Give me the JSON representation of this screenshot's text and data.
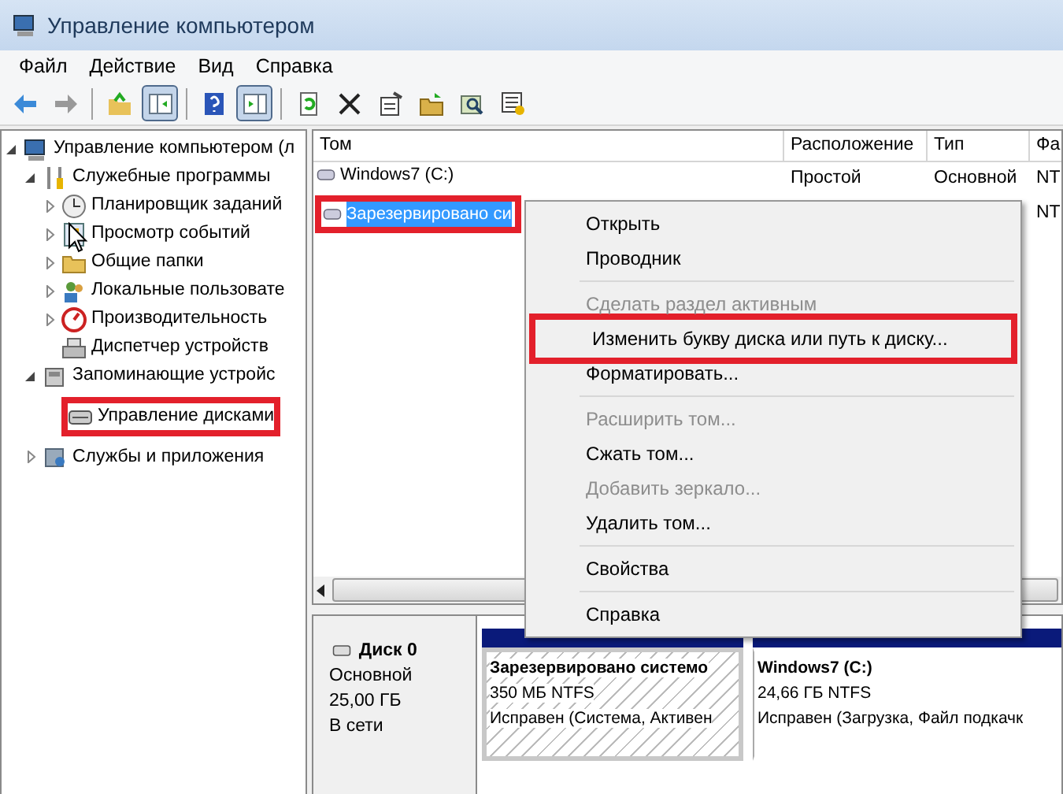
{
  "window": {
    "title": "Управление компьютером"
  },
  "menu_bar": [
    "Файл",
    "Действие",
    "Вид",
    "Справка"
  ],
  "toolbar": [
    {
      "kind": "back",
      "pressed": false
    },
    {
      "kind": "forward",
      "pressed": false
    },
    {
      "kind": "separator"
    },
    {
      "kind": "folder-up",
      "pressed": false
    },
    {
      "kind": "tree-pane",
      "pressed": true
    },
    {
      "kind": "separator"
    },
    {
      "kind": "help",
      "pressed": false
    },
    {
      "kind": "action-pane",
      "pressed": true
    },
    {
      "kind": "separator"
    },
    {
      "kind": "refresh",
      "pressed": false
    },
    {
      "kind": "delete",
      "pressed": false
    },
    {
      "kind": "properties",
      "pressed": false
    },
    {
      "kind": "open",
      "pressed": false
    },
    {
      "kind": "find",
      "pressed": false
    },
    {
      "kind": "export",
      "pressed": false
    }
  ],
  "tree": [
    {
      "label": "Управление компьютером (л",
      "expanded": true,
      "children": [
        {
          "label": "Служебные программы",
          "expanded": true,
          "children": [
            {
              "label": "Планировщик заданий",
              "expanded": false
            },
            {
              "label": "Просмотр событий",
              "expanded": false
            },
            {
              "label": "Общие папки",
              "expanded": false
            },
            {
              "label": "Локальные пользовате",
              "expanded": false
            },
            {
              "label": "Производительность",
              "expanded": false
            },
            {
              "label": "Диспетчер устройств"
            }
          ]
        },
        {
          "label": "Запоминающие устройс",
          "expanded": true,
          "children": [
            {
              "label": "Управление дисками",
              "highlighted": true
            }
          ]
        },
        {
          "label": "Службы и приложения",
          "expanded": false
        }
      ]
    }
  ],
  "volumes": {
    "columns": [
      "Том",
      "Расположение",
      "Тип",
      "Фа"
    ],
    "rows": [
      {
        "cells": [
          "Windows7 (C:)",
          "Простой",
          "Основной",
          "NT"
        ],
        "selected": false
      },
      {
        "cells": [
          "Зарезервировано си",
          "",
          "",
          "NT"
        ],
        "selected": true,
        "highlighted": true
      }
    ]
  },
  "context_menu": [
    {
      "kind": "item",
      "label": "Открыть",
      "disabled": false
    },
    {
      "kind": "item",
      "label": "Проводник",
      "disabled": false
    },
    {
      "kind": "separator"
    },
    {
      "kind": "item",
      "label": "Сделать раздел активным",
      "disabled": true
    },
    {
      "kind": "item",
      "label": "Изменить букву диска или путь к диску...",
      "disabled": false,
      "highlighted": true
    },
    {
      "kind": "item",
      "label": "Форматировать...",
      "disabled": false
    },
    {
      "kind": "separator"
    },
    {
      "kind": "item",
      "label": "Расширить том...",
      "disabled": true
    },
    {
      "kind": "item",
      "label": "Сжать том...",
      "disabled": false
    },
    {
      "kind": "item",
      "label": "Добавить зеркало...",
      "disabled": true
    },
    {
      "kind": "item",
      "label": "Удалить том...",
      "disabled": false
    },
    {
      "kind": "separator"
    },
    {
      "kind": "item",
      "label": "Свойства",
      "disabled": false
    },
    {
      "kind": "separator"
    },
    {
      "kind": "item",
      "label": "Справка",
      "disabled": false
    }
  ],
  "disks": [
    {
      "name": "Диск 0",
      "type": "Основной",
      "size": "25,00 ГБ",
      "status": "В сети",
      "partitions": [
        {
          "name": "Зарезервировано системо",
          "size": "350 МБ NTFS",
          "status": "Исправен (Система, Активен",
          "kind": "hatched"
        },
        {
          "name": "Windows7  (C:)",
          "size": "24,66 ГБ NTFS",
          "status": "Исправен (Загрузка, Файл подкачк",
          "kind": "plain"
        }
      ]
    }
  ]
}
